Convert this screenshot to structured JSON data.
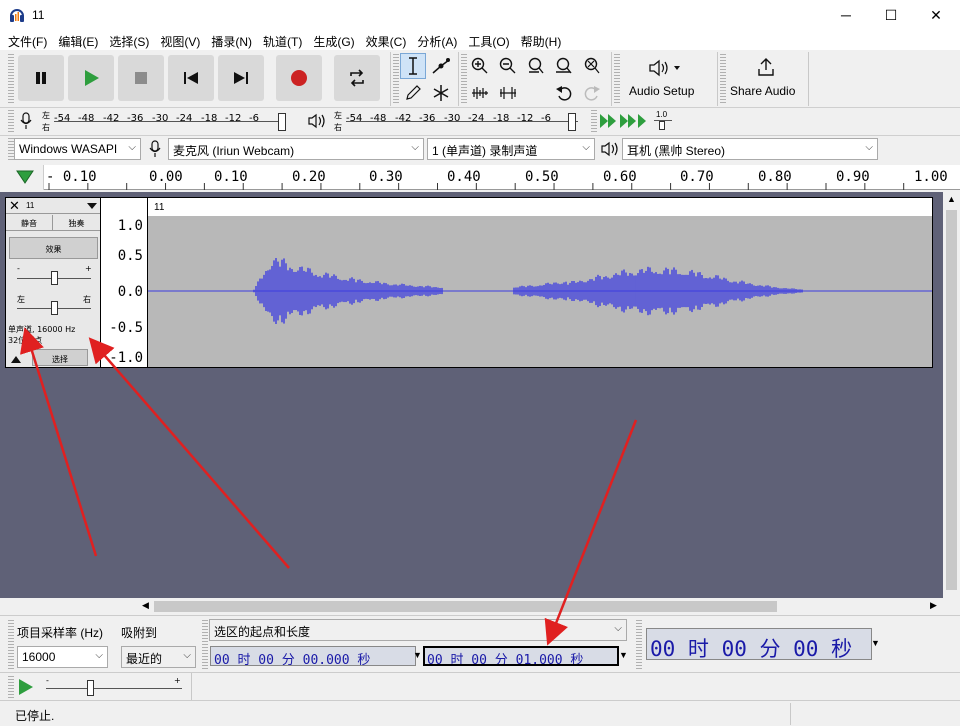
{
  "window": {
    "title": "11",
    "minimize": "─",
    "maximize": "☐",
    "close": "✕"
  },
  "menu": [
    "文件(F)",
    "编辑(E)",
    "选择(S)",
    "视图(V)",
    "播录(N)",
    "轨道(T)",
    "生成(G)",
    "效果(C)",
    "分析(A)",
    "工具(O)",
    "帮助(H)"
  ],
  "toolbar": {
    "audio_setup_label": "Audio Setup",
    "share_audio_label": "Share Audio"
  },
  "meters": {
    "record_lr": [
      "左",
      "右"
    ],
    "playback_lr": [
      "左",
      "右"
    ],
    "scale": [
      "-54",
      "-48",
      "-42",
      "-36",
      "-30",
      "-24",
      "-18",
      "-12",
      "-6"
    ],
    "level_value": "1.0"
  },
  "devices": {
    "host": "Windows WASAPI",
    "mic": "麦克风 (Iriun Webcam)",
    "channels": "1 (单声道) 录制声道",
    "output": "耳机 (黑帅 Stereo)"
  },
  "ruler": {
    "ticks": [
      "- 0.10",
      "0.00",
      "0.10",
      "0.20",
      "0.30",
      "0.40",
      "0.50",
      "0.60",
      "0.70",
      "0.80",
      "0.90",
      "1.00"
    ]
  },
  "track": {
    "name": "11",
    "mute": "静音",
    "solo": "独奏",
    "effects": "效果",
    "gain_minus": "-",
    "gain_plus": "+",
    "pan_left": "左",
    "pan_right": "右",
    "info_line1": "单声道, 16000 Hz",
    "info_line2": "32位浮点",
    "select": "选择",
    "clip_name": "11",
    "scale": [
      "1.0",
      "0.5",
      "0.0",
      "-0.5",
      "-1.0"
    ]
  },
  "selection_bar": {
    "project_rate_label": "项目采样率 (Hz)",
    "snap_label": "吸附到",
    "project_rate_value": "16000",
    "snap_value": "最近的",
    "selection_mode": "选区的起点和长度",
    "start_time": "00 时 00 分 00.000 秒",
    "length_time": "00 时 00 分 01.000 秒",
    "audio_position": "00 时 00 分 00 秒"
  },
  "status": {
    "text": "已停止."
  },
  "colors": {
    "waveform": "#3d3de0",
    "track_background": "#5f6177",
    "clip_background": "#b8b8b8",
    "record_red": "#cc2222",
    "play_green": "#2e9e3e",
    "annotation_red": "#e02020"
  }
}
